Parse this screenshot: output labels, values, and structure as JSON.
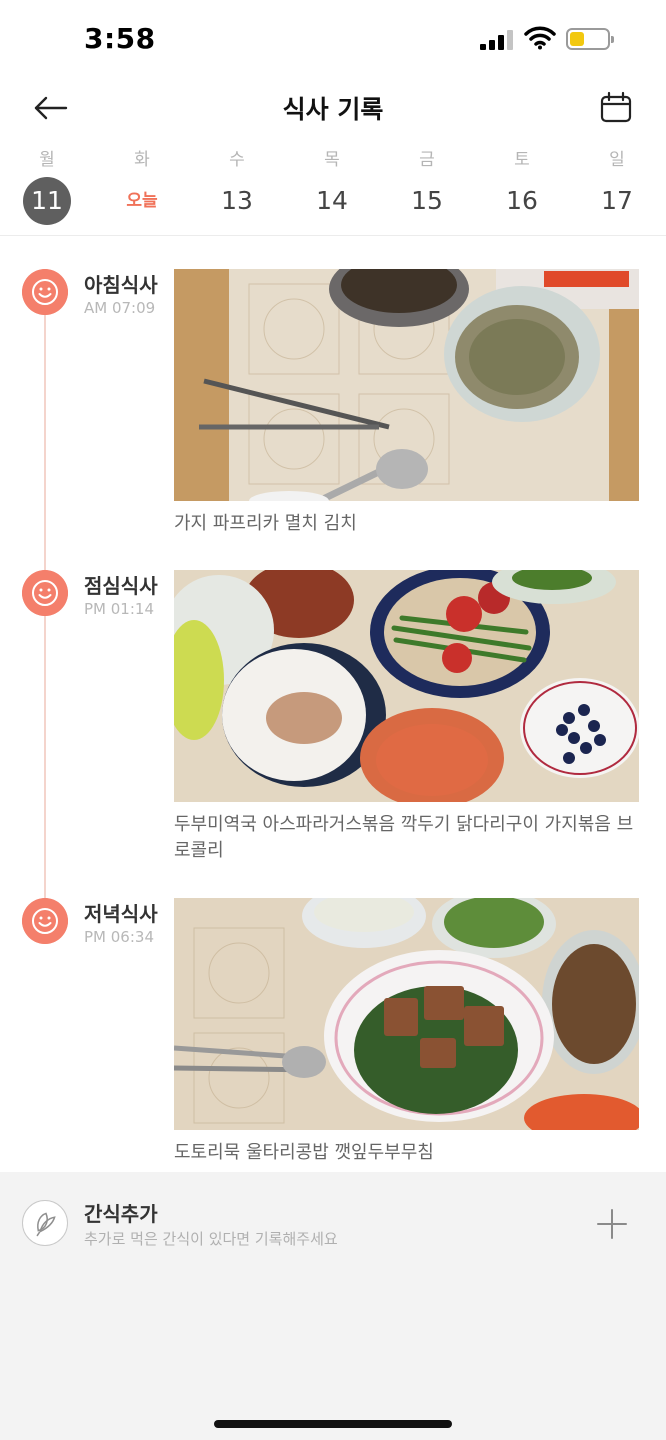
{
  "status_bar": {
    "time": "3:58"
  },
  "header": {
    "title": "식사 기록",
    "back_icon": "arrow-left-icon",
    "calendar_icon": "calendar-icon"
  },
  "week": [
    {
      "name": "월",
      "label": "11",
      "state": "selected"
    },
    {
      "name": "화",
      "label": "오늘",
      "state": "today"
    },
    {
      "name": "수",
      "label": "13",
      "state": "normal"
    },
    {
      "name": "목",
      "label": "14",
      "state": "normal"
    },
    {
      "name": "금",
      "label": "15",
      "state": "normal"
    },
    {
      "name": "토",
      "label": "16",
      "state": "normal"
    },
    {
      "name": "일",
      "label": "17",
      "state": "normal"
    }
  ],
  "meals": [
    {
      "type": "아침식사",
      "time": "AM 07:09",
      "foods": "가지 파프리카 멸치 김치",
      "icon": "smiley-icon"
    },
    {
      "type": "점심식사",
      "time": "PM 01:14",
      "foods": "두부미역국 아스파라거스볶음 깍두기 닭다리구이 가지볶음 브로콜리",
      "icon": "smiley-icon"
    },
    {
      "type": "저녁식사",
      "time": "PM 06:34",
      "foods": "도토리묵 울타리콩밥 깻잎두부무침",
      "icon": "smiley-icon"
    }
  ],
  "snack": {
    "title": "간식추가",
    "subtitle": "추가로 먹은 간식이 있다면 기록해주세요",
    "icon": "leaf-icon",
    "add_icon": "plus-icon"
  },
  "colors": {
    "accent": "#f47f6b",
    "today": "#f07259",
    "selected_day": "#5f5f5f",
    "battery": "#f2c80f"
  }
}
